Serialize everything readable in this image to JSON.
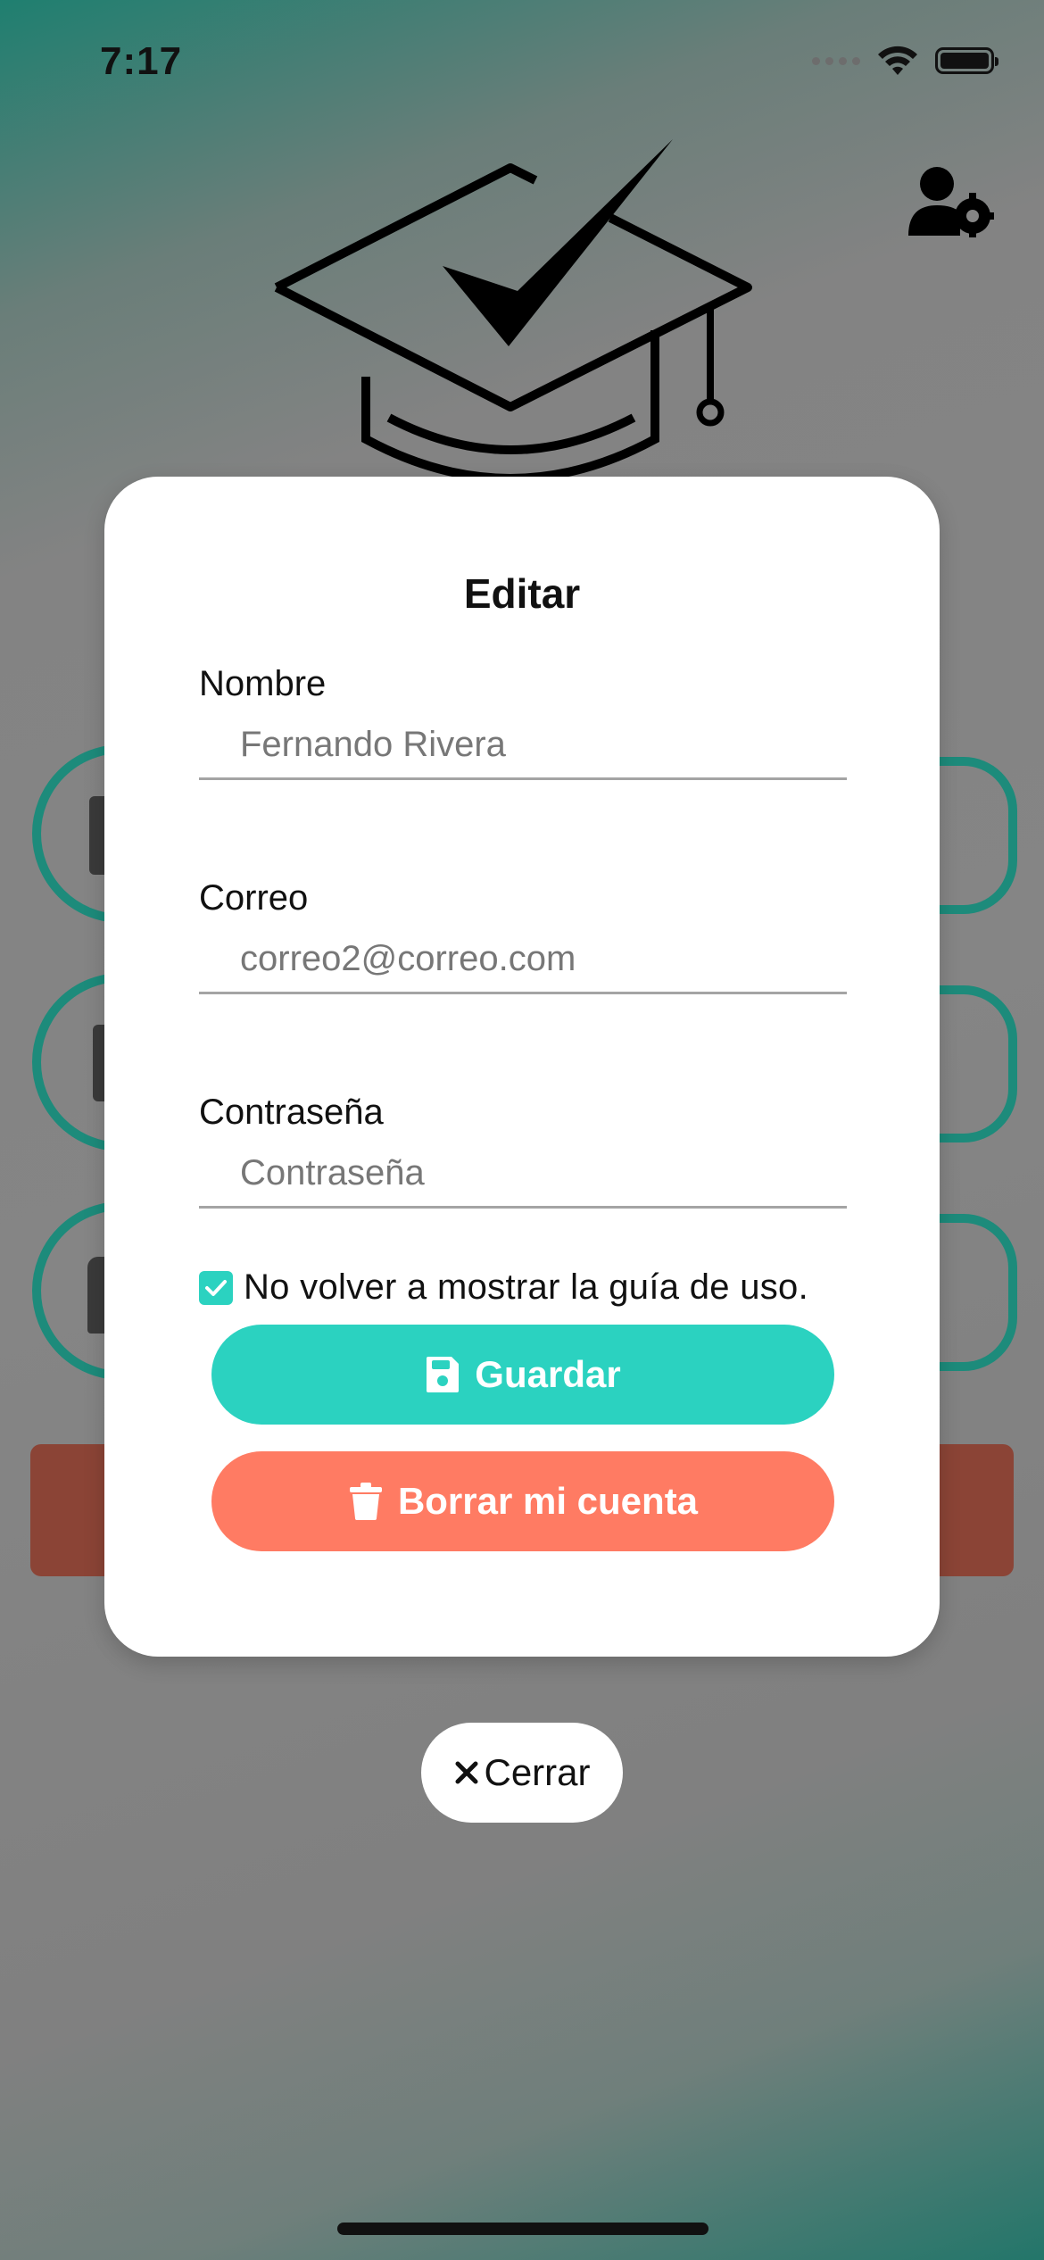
{
  "status_bar": {
    "time": "7:17",
    "icons": [
      "signal-icon",
      "wifi-icon",
      "battery-icon"
    ]
  },
  "header": {
    "settings_icon": "user-gear-icon",
    "logo_icon": "graduation-cap-check-icon"
  },
  "modal": {
    "title": "Editar",
    "fields": [
      {
        "label": "Nombre",
        "value": "Fernando Rivera",
        "placeholder": ""
      },
      {
        "label": "Correo",
        "value": "correo2@correo.com",
        "placeholder": ""
      },
      {
        "label": "Contraseña",
        "value": "",
        "placeholder": "Contraseña"
      }
    ],
    "checkbox": {
      "label": "No volver a mostrar la guía de uso.",
      "checked": true
    },
    "save_button": {
      "label": "Guardar",
      "icon": "floppy-disk-icon"
    },
    "delete_button": {
      "label": "Borrar mi cuenta",
      "icon": "trash-icon"
    }
  },
  "close_button": {
    "label": "Cerrar",
    "icon": "close-icon"
  },
  "colors": {
    "accent": "#2bd2c0",
    "danger": "#ff7b63",
    "teal_bg": "#1d8b7b",
    "overlay_gray": "#858585"
  }
}
